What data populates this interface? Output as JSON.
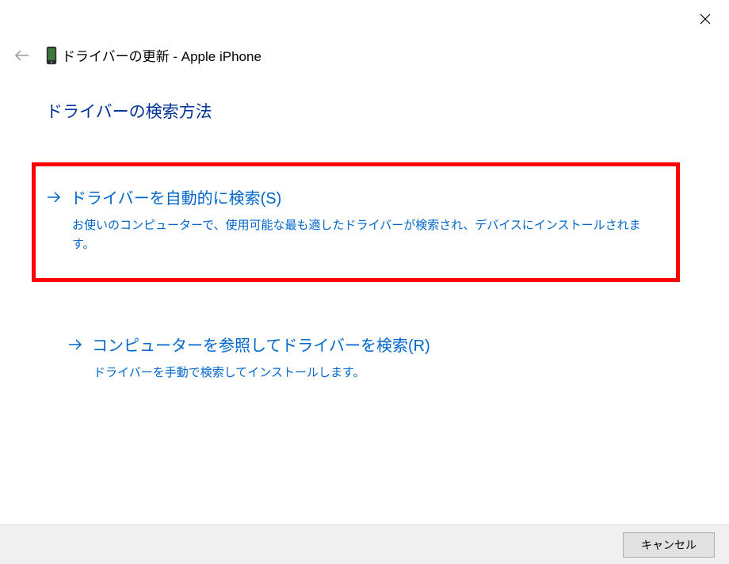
{
  "window": {
    "title": "ドライバーの更新 - Apple iPhone"
  },
  "heading": "ドライバーの検索方法",
  "options": [
    {
      "title": "ドライバーを自動的に検索(S)",
      "description": "お使いのコンピューターで、使用可能な最も適したドライバーが検索され、デバイスにインストールされます。"
    },
    {
      "title": "コンピューターを参照してドライバーを検索(R)",
      "description": "ドライバーを手動で検索してインストールします。"
    }
  ],
  "footer": {
    "cancel": "キャンセル"
  }
}
